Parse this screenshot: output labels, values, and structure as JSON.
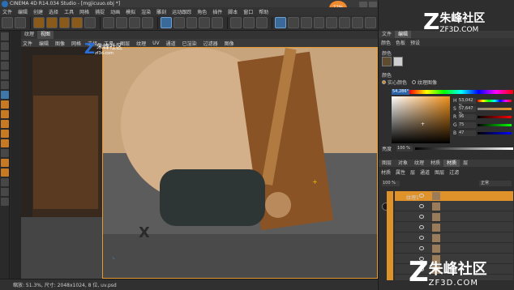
{
  "window": {
    "title": "CINEMA 4D R14.034 Studio - [mgjicuuo.obj *]",
    "progress_badge": "77%"
  },
  "menu": [
    "文件",
    "编辑",
    "创建",
    "选择",
    "工具",
    "网格",
    "捕捉",
    "动画",
    "模拟",
    "渲染",
    "雕刻",
    "运动跟踪",
    "角色",
    "插件",
    "脚本",
    "窗口",
    "帮助"
  ],
  "viewport": {
    "tabs": [
      "纹理",
      "视图"
    ],
    "menu": [
      "文件",
      "编辑",
      "图像",
      "网格",
      "选择",
      "工具",
      "图层",
      "纹理",
      "UV",
      "通道",
      "已渲染",
      "过滤器",
      "图像"
    ]
  },
  "status_bar": {
    "text": "缩放: 51.3%, 尺寸: 2048x1024, 8 位, uv.psd"
  },
  "attribute_panel": {
    "tabs": [
      "文件",
      "编辑"
    ],
    "subtabs": [
      "颜色",
      "色板",
      "预设"
    ],
    "swatches_label": "颜色",
    "colors_label": "颜色",
    "mode_radio": [
      "实心颜色",
      "纹理图像"
    ],
    "hex_value": "54,286°",
    "sliders": [
      {
        "label": "H",
        "value": "53,042 %"
      },
      {
        "label": "S",
        "value": "57,647 %"
      },
      {
        "label": "R",
        "value": "96"
      },
      {
        "label": "G",
        "value": "75"
      },
      {
        "label": "B",
        "value": "47"
      }
    ],
    "brightness_label": "亮度",
    "brightness_value": "100 %"
  },
  "layers_panel": {
    "tabs": [
      "图层",
      "对象",
      "纹理",
      "材质",
      "材质",
      "层"
    ],
    "subtabs": [
      "材质",
      "属性",
      "层",
      "通道",
      "图层",
      "过滤"
    ],
    "opacity": "100 %",
    "blend_mode": "正常",
    "rows": [
      {
        "name": "纹理1",
        "selected": true
      },
      {
        "name": "",
        "selected": false
      },
      {
        "name": "",
        "selected": false
      },
      {
        "name": "",
        "selected": false
      },
      {
        "name": "",
        "selected": false
      },
      {
        "name": "",
        "selected": false
      },
      {
        "name": "",
        "selected": false
      },
      {
        "name": "",
        "selected": false
      }
    ]
  },
  "watermark": {
    "small_line1": "朱峰社区",
    "small_line2": "zf3d.com",
    "top_line1": "朱峰社区",
    "top_line2": "ZF3D.COM",
    "bottom_line1": "朱峰社区",
    "bottom_line2": "ZF3D.COM"
  },
  "colors": {
    "accent_orange": "#e0922a",
    "selection_blue": "#2b63a8",
    "panel_bg": "#2e2e2e"
  }
}
